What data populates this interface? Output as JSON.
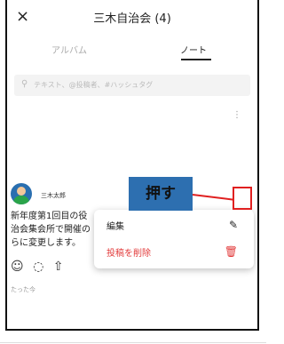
{
  "header": {
    "close_glyph": "×",
    "title": "三木自治会 (4)"
  },
  "tabs": [
    {
      "label": "アルバム",
      "active": false
    },
    {
      "label": "ノート",
      "active": true
    }
  ],
  "search": {
    "placeholder": "テキスト、@投稿者、#ハッシュタグ"
  },
  "post": {
    "author": "三木太郎",
    "text_lines": [
      "新年度第1回目の役",
      "治会集会所で開催の",
      "らに変更します。"
    ],
    "time": "たった今"
  },
  "callout": {
    "label": "押す",
    "color": "#2d6fb0",
    "arrow_color": "#e02020"
  },
  "menu": {
    "edit_label": "編集",
    "delete_label": "投稿を削除",
    "delete_color": "#e23a3a"
  },
  "icons": {
    "kebab": "⋮",
    "search": "⚲",
    "emoji": "☺",
    "comment": "◌",
    "share": "⇧",
    "edit": "✎",
    "trash": "🗑"
  }
}
